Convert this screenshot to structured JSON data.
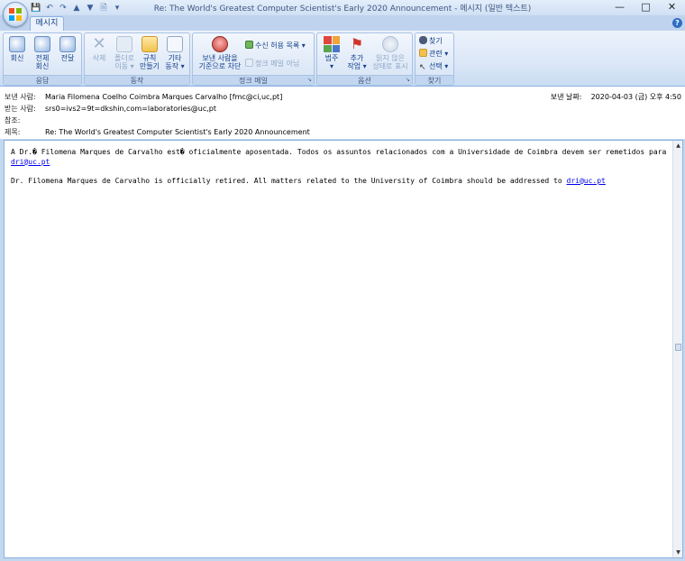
{
  "window": {
    "title": "Re: The World's Greatest Computer Scientist's Early 2020 Announcement - 메시지 (일반 텍스트)",
    "controls": [
      "minimize",
      "maximize",
      "close"
    ]
  },
  "quick_access": [
    "save-icon",
    "undo-icon",
    "redo-icon",
    "up-arrow-icon",
    "down-arrow-icon",
    "print-preview-icon",
    "customize-icon"
  ],
  "tabs": {
    "active": "메시지"
  },
  "ribbon": {
    "groups": {
      "respond": {
        "label": "응답",
        "reply": "회신",
        "reply_all_1": "전체",
        "reply_all_2": "회신",
        "forward": "전달"
      },
      "actions": {
        "label": "동작",
        "delete": "삭제",
        "move_1": "폴더로",
        "move_2": "이동 ▾",
        "rules_1": "규칙",
        "rules_2": "만들기",
        "other_1": "기타",
        "other_2": "동작 ▾"
      },
      "junk": {
        "label": "정크 메일",
        "block_1": "보낸 사람을",
        "block_2": "기준으로 차단",
        "safe_list": "수신 허용 목록 ▾",
        "not_junk": "정크 메일 아님"
      },
      "options": {
        "label": "옵션",
        "categorize_1": "범주",
        "categorize_2": "▾",
        "followup_1": "추가",
        "followup_2": "작업 ▾",
        "mark_unread_1": "읽지 않은",
        "mark_unread_2": "상태로 표시"
      },
      "find": {
        "label": "찾기",
        "find": "찾기",
        "related": "관련 ▾",
        "select": "선택 ▾"
      }
    }
  },
  "message": {
    "from_label": "보낸 사람:",
    "from_value": "Maria Filomena Coelho Coimbra Marques Carvalho [fmc@ci,uc,pt]",
    "to_label": "받는 사람:",
    "to_value": "srs0=ivs2=9t=dkshin,com=laboratories@uc,pt",
    "cc_label": "참조:",
    "cc_value": "",
    "subject_label": "제목:",
    "subject_value": "Re: The World's Greatest Computer Scientist's Early 2020 Announcement",
    "sent_label": "보낸 날짜:",
    "sent_value": "2020-04-03 (금) 오후 4:50"
  },
  "body": {
    "para1_text": "A Dr.� Filomena Marques de Carvalho est� oficialmente aposentada. Todos os assuntos relacionados com a Universidade de Coimbra devem ser remetidos para ",
    "para1_link": "dri@uc.pt",
    "para2_text": "Dr. Filomena Marques de Carvalho is officially retired. All matters related to the University of Coimbra should be addressed  to ",
    "para2_link": "dri@uc.pt"
  },
  "colors": {
    "ribbon_bg": "#dbe7f7",
    "title_text": "#3e5780",
    "link": "#0000ee"
  }
}
